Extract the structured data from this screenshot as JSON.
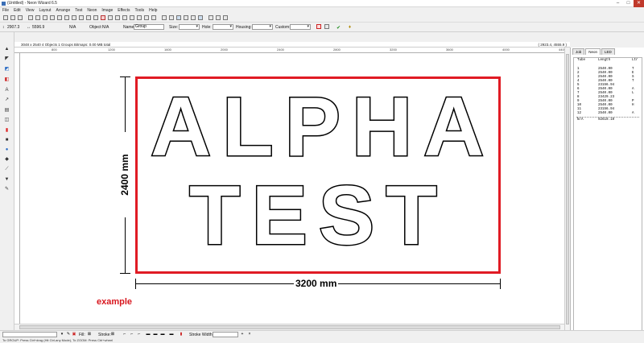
{
  "window": {
    "title": "(Untitled) - Neon Wizard 6.5"
  },
  "menu": [
    "File",
    "Edit",
    "View",
    "Layout",
    "Arrange",
    "Test",
    "Neon",
    "Image",
    "Effects",
    "Tools",
    "Help"
  ],
  "props": {
    "x_value": "2907.3",
    "y_value": "5596.9",
    "size_na": "N/A",
    "object_label": "Object:",
    "object_value": "N/A",
    "name_label": "Name:",
    "name_value": "Group",
    "size_label": "Size:",
    "hole_label": "Hole:",
    "housing_label": "Housing:",
    "custom_label": "Custom:"
  },
  "info": {
    "left": "3048 x 2540  4 Objects  1 Groups  Bitmaps: 0.00 MB total",
    "right": "( 2923.4, 4555.9 )"
  },
  "ruler": {
    "h": [
      "800",
      "1200",
      "1600",
      "2000",
      "2400",
      "2800",
      "3200",
      "3600",
      "4000",
      "4400"
    ]
  },
  "canvas": {
    "line1": "ALPHA",
    "line2": "TEST",
    "width_label": "3200 mm",
    "height_label": "2400 mm",
    "example_label": "example"
  },
  "panel": {
    "tabs": [
      "Job",
      "Neon",
      "LED"
    ],
    "active_tab": "Neon",
    "headers": {
      "tube": "Tube",
      "length": "Length",
      "ltr": "Ltr"
    },
    "rows": [
      {
        "tube": "1",
        "length": "2540.00",
        "ltr": "T"
      },
      {
        "tube": "2",
        "length": "2540.00",
        "ltr": "E"
      },
      {
        "tube": "3",
        "length": "2540.00",
        "ltr": "S"
      },
      {
        "tube": "4",
        "length": "2540.00",
        "ltr": "T"
      },
      {
        "tube": "5",
        "length": "23156.94",
        "ltr": ""
      },
      {
        "tube": "6",
        "length": "2540.00",
        "ltr": "A"
      },
      {
        "tube": "7",
        "length": "2540.00",
        "ltr": "L"
      },
      {
        "tube": "8",
        "length": "23429.23",
        "ltr": ""
      },
      {
        "tube": "9",
        "length": "2540.00",
        "ltr": "P"
      },
      {
        "tube": "10",
        "length": "2540.00",
        "ltr": "H"
      },
      {
        "tube": "11",
        "length": "23156.94",
        "ltr": ""
      },
      {
        "tube": "12",
        "length": "2540.00",
        "ltr": "A"
      }
    ],
    "total": {
      "tube": "N/A",
      "length": "92619.10"
    }
  },
  "bottom": {
    "fill_label": "Fill:",
    "stroke_label": "Stroke:",
    "stroke_width_label": "Stroke Width:"
  },
  "status": "To GROUP: Press Ctrl+drag (Hit Ctrl-any Mode), To ZOOM: Press Ctrl+wheel"
}
